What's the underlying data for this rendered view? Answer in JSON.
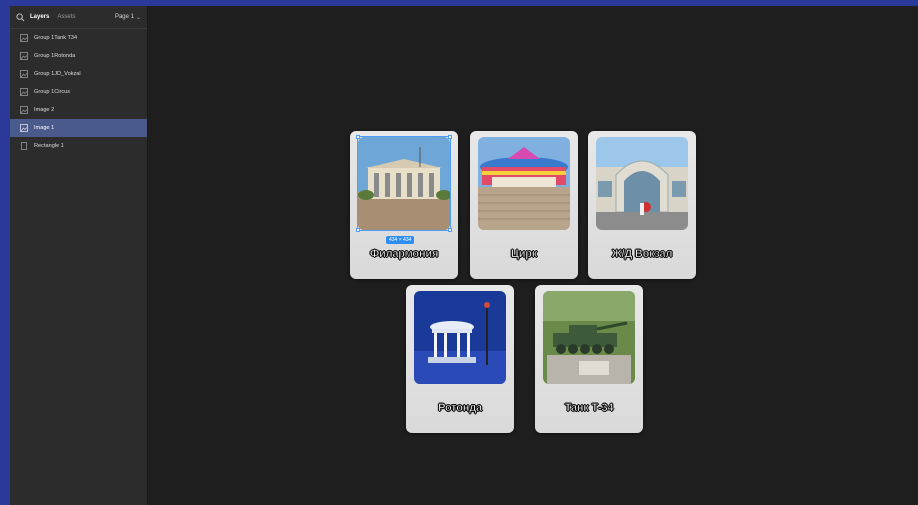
{
  "sidebar": {
    "tabs": [
      {
        "label": "Layers"
      },
      {
        "label": "Assets"
      }
    ],
    "page_selector": "Page 1",
    "layers": [
      {
        "label": "Group 1Tank T34",
        "icon": "image-icon"
      },
      {
        "label": "Group 1Rotonda",
        "icon": "image-icon"
      },
      {
        "label": "Group 1JD_Vokzal",
        "icon": "image-icon"
      },
      {
        "label": "Group 1Circus",
        "icon": "image-icon"
      },
      {
        "label": "Image 2",
        "icon": "image-icon"
      },
      {
        "label": "Image 1",
        "icon": "image-icon",
        "selected": true
      },
      {
        "label": "Rectangle 1",
        "icon": "rectangle-icon"
      }
    ]
  },
  "canvas": {
    "selection_size": "434 × 434",
    "cards": [
      {
        "label": "Филармония",
        "image": "philharmonic-photo"
      },
      {
        "label": "Цирк",
        "image": "circus-photo"
      },
      {
        "label": "Ж/Д Вокзал",
        "image": "railway-station-photo"
      },
      {
        "label": "Ротонда",
        "image": "rotunda-photo"
      },
      {
        "label": "Танк Т-34",
        "image": "tank-photo"
      }
    ]
  },
  "colors": {
    "outer_background": "#2b3a9a",
    "canvas": "#1e1e1e",
    "sidebar": "#2c2c2c",
    "selected_layer": "#4a5a8a",
    "selection_accent": "#4c9ef8",
    "card": "#e0e0e0"
  }
}
